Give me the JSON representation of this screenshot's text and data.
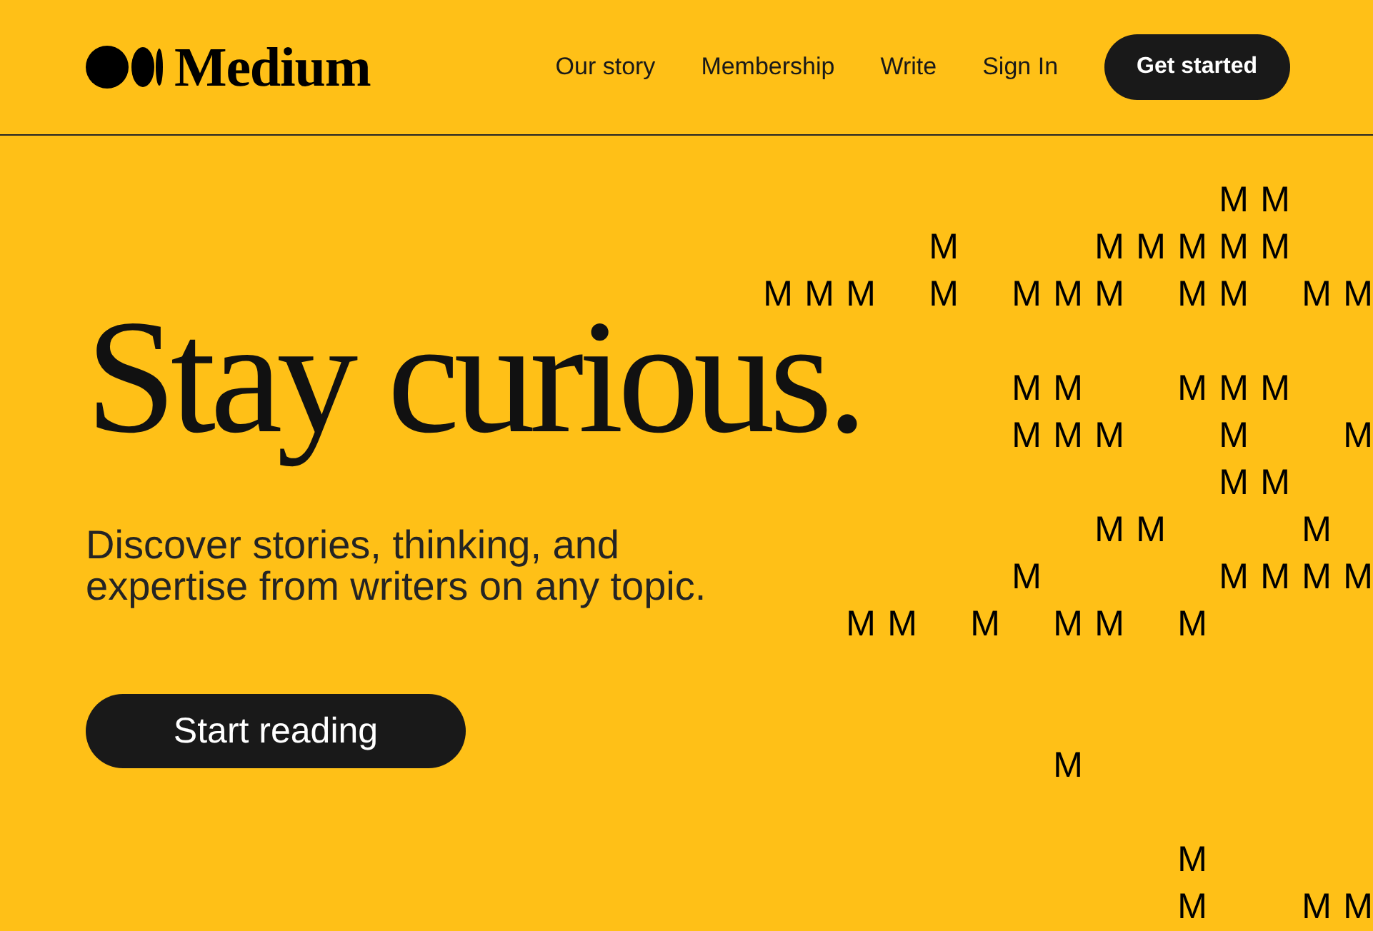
{
  "header": {
    "logo": {
      "wordmark": "Medium"
    },
    "nav": [
      {
        "label": "Our story",
        "kind": "link"
      },
      {
        "label": "Membership",
        "kind": "link"
      },
      {
        "label": "Write",
        "kind": "link"
      },
      {
        "label": "Sign In",
        "kind": "link"
      },
      {
        "label": "Get started",
        "kind": "button"
      }
    ]
  },
  "hero": {
    "title": "Stay curious.",
    "subtitle": "Discover stories, thinking, and expertise from writers on any topic.",
    "button": "Start reading"
  },
  "letter_grid": {
    "rows": [
      [
        null,
        null,
        null,
        null,
        null,
        null,
        null,
        null,
        null,
        null,
        null,
        "M",
        "M",
        null,
        null
      ],
      [
        null,
        null,
        null,
        null,
        "M",
        null,
        null,
        null,
        "M",
        "M",
        "M",
        "M",
        "M",
        null,
        null
      ],
      [
        "M",
        "M",
        "M",
        null,
        "M",
        null,
        "M",
        "M",
        "M",
        null,
        "M",
        "M",
        null,
        "M",
        "M"
      ],
      [
        null,
        null,
        null,
        null,
        null,
        null,
        null,
        null,
        null,
        null,
        null,
        null,
        null,
        null,
        null
      ],
      [
        null,
        null,
        null,
        null,
        null,
        null,
        "M",
        "M",
        null,
        null,
        "M",
        "M",
        "M",
        null,
        null
      ],
      [
        null,
        null,
        null,
        null,
        null,
        null,
        "M",
        "M",
        "M",
        null,
        null,
        "M",
        null,
        null,
        "M"
      ],
      [
        null,
        null,
        null,
        null,
        null,
        null,
        null,
        null,
        null,
        null,
        null,
        "M",
        "M",
        null,
        null
      ],
      [
        null,
        null,
        null,
        null,
        null,
        null,
        null,
        null,
        "M",
        "M",
        null,
        null,
        null,
        "M",
        null
      ],
      [
        null,
        null,
        null,
        null,
        null,
        null,
        "M",
        null,
        null,
        null,
        null,
        "M",
        "M",
        "M",
        "M"
      ],
      [
        null,
        null,
        "M",
        "M",
        null,
        "M",
        null,
        "M",
        "M",
        null,
        "M",
        null,
        null,
        null,
        null
      ],
      [
        null,
        null,
        null,
        null,
        null,
        null,
        null,
        null,
        null,
        null,
        null,
        null,
        null,
        null,
        null
      ],
      [
        null,
        null,
        null,
        null,
        null,
        null,
        null,
        null,
        null,
        null,
        null,
        null,
        null,
        null,
        null
      ],
      [
        null,
        null,
        null,
        null,
        null,
        null,
        null,
        "M",
        null,
        null,
        null,
        null,
        null,
        null,
        null
      ],
      [
        null,
        null,
        null,
        null,
        null,
        null,
        null,
        null,
        null,
        null,
        null,
        null,
        null,
        null,
        null
      ],
      [
        null,
        null,
        null,
        null,
        null,
        null,
        null,
        null,
        null,
        null,
        "M",
        null,
        null,
        null,
        null
      ],
      [
        null,
        null,
        null,
        null,
        null,
        null,
        null,
        null,
        null,
        null,
        "M",
        null,
        null,
        "M",
        "M"
      ]
    ]
  }
}
